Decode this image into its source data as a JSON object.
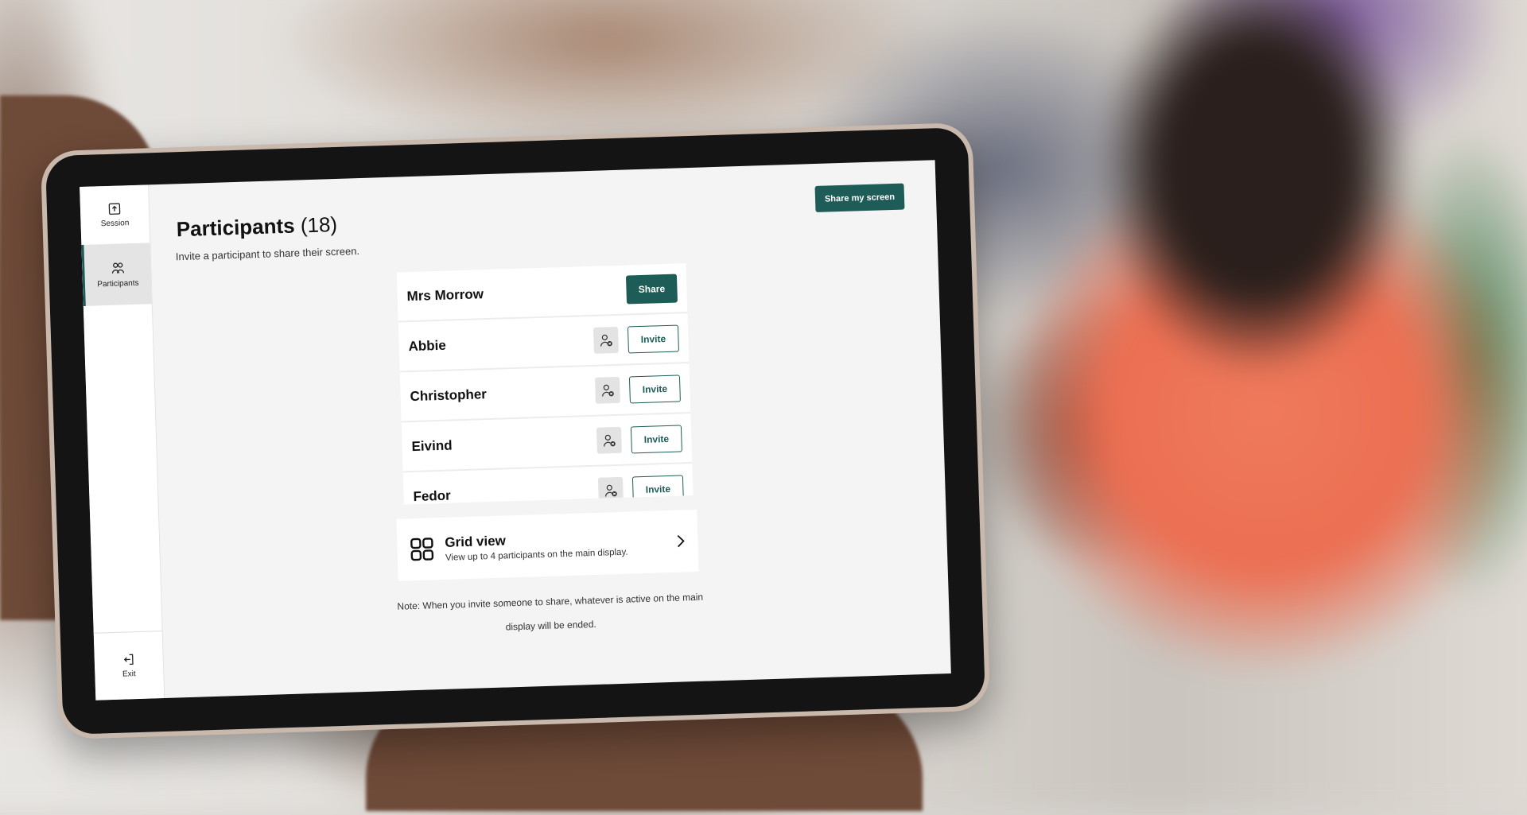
{
  "sidebar": {
    "items": [
      {
        "label": "Session",
        "icon": "share-upload-icon",
        "active": false
      },
      {
        "label": "Participants",
        "icon": "participants-icon",
        "active": true
      }
    ],
    "exit": {
      "label": "Exit",
      "icon": "exit-icon"
    }
  },
  "header": {
    "title": "Participants",
    "count": "(18)",
    "subtitle": "Invite a participant to share their screen.",
    "share_my_screen_label": "Share my screen"
  },
  "participants": [
    {
      "name": "Mrs Morrow",
      "action": "Share"
    },
    {
      "name": "Abbie",
      "action": "Invite"
    },
    {
      "name": "Christopher",
      "action": "Invite"
    },
    {
      "name": "Eivind",
      "action": "Invite"
    },
    {
      "name": "Fedor",
      "action": "Invite"
    }
  ],
  "grid_view": {
    "title": "Grid view",
    "description": "View up to 4 participants on the main display.",
    "icon": "grid-icon"
  },
  "note": "Note: When you invite someone to share, whatever is active on the main display will be ended.",
  "colors": {
    "accent": "#1d5c57",
    "background": "#f4f4f4"
  }
}
